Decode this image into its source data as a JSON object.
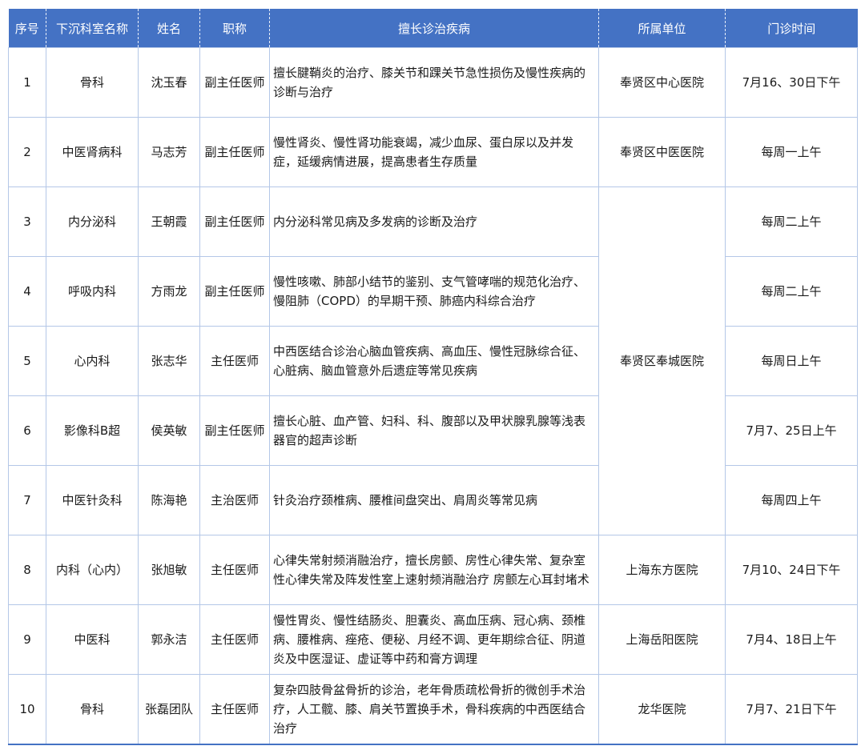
{
  "colors": {
    "header_bg": "#4472c4",
    "header_text": "#ffffff",
    "border": "#b4c7e7"
  },
  "headers": [
    "序号",
    "下沉科室名称",
    "姓名",
    "职称",
    "擅长诊治疾病",
    "所属单位",
    "门诊时间"
  ],
  "rows": [
    {
      "no": "1",
      "dept": "骨科",
      "name": "沈玉春",
      "title": "副主任医师",
      "specialty": "擅长腱鞘炎的治疗、膝关节和踝关节急性损伤及慢性疾病的诊断与治疗",
      "unit": "奉贤区中心医院",
      "time": "7月16、30日下午"
    },
    {
      "no": "2",
      "dept": "中医肾病科",
      "name": "马志芳",
      "title": "副主任医师",
      "specialty": "慢性肾炎、慢性肾功能衰竭，减少血尿、蛋白尿以及并发症，延缓病情进展，提高患者生存质量",
      "unit": "奉贤区中医医院",
      "time": "每周一上午"
    },
    {
      "no": "3",
      "dept": "内分泌科",
      "name": "王朝霞",
      "title": "副主任医师",
      "specialty": "内分泌科常见病及多发病的诊断及治疗",
      "unit": "奉贤区奉城医院",
      "time": "每周二上午"
    },
    {
      "no": "4",
      "dept": "呼吸内科",
      "name": "方雨龙",
      "title": "副主任医师",
      "specialty": "慢性咳嗽、肺部小结节的鉴别、支气管哮喘的规范化治疗、慢阻肺（COPD）的早期干预、肺癌内科综合治疗",
      "unit": "",
      "time": "每周二上午"
    },
    {
      "no": "5",
      "dept": "心内科",
      "name": "张志华",
      "title": "主任医师",
      "specialty": "中西医结合诊治心脑血管疾病、高血压、慢性冠脉综合征、心脏病、脑血管意外后遗症等常见疾病",
      "unit": "",
      "time": "每周日上午"
    },
    {
      "no": "6",
      "dept": "影像科B超",
      "name": "侯英敏",
      "title": "副主任医师",
      "specialty": "擅长心脏、血产管、妇科、科、腹部以及甲状腺乳腺等浅表器官的超声诊断",
      "unit": "",
      "time": "7月7、25日上午"
    },
    {
      "no": "7",
      "dept": "中医针灸科",
      "name": "陈海艳",
      "title": "主治医师",
      "specialty": "针灸治疗颈椎病、腰椎间盘突出、肩周炎等常见病",
      "unit": "",
      "time": "每周四上午"
    },
    {
      "no": "8",
      "dept": "内科（心内）",
      "name": "张旭敏",
      "title": "主任医师",
      "specialty": "心律失常射频消融治疗，擅长房颤、房性心律失常、复杂室性心律失常及阵发性室上速射频消融治疗 房颤左心耳封堵术",
      "unit": "上海东方医院",
      "time": "7月10、24日下午"
    },
    {
      "no": "9",
      "dept": "中医科",
      "name": "郭永洁",
      "title": "主任医师",
      "specialty": "慢性胃炎、慢性结肠炎、胆囊炎、高血压病、冠心病、颈椎病、腰椎病、痤疮、便秘、月经不调、更年期综合征、阴道炎及中医湿证、虚证等中药和膏方调理",
      "unit": "上海岳阳医院",
      "time": "7月4、18日上午"
    },
    {
      "no": "10",
      "dept": "骨科",
      "name": "张磊团队",
      "title": "主任医师",
      "specialty": "复杂四肢骨盆骨折的诊治，老年骨质疏松骨折的微创手术治疗，人工髋、膝、肩关节置换手术，骨科疾病的中西医结合治疗",
      "unit": "龙华医院",
      "time": "7月7、21日下午"
    }
  ]
}
